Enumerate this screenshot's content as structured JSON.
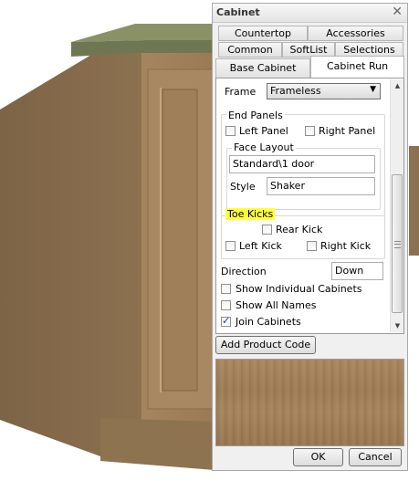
{
  "dialog": {
    "title": "Cabinet",
    "close_glyph": "✕"
  },
  "tabs": {
    "row1": [
      "Countertop",
      "Accessories"
    ],
    "row2": [
      "Common",
      "SoftList",
      "Selections"
    ],
    "row3": [
      "Base Cabinet",
      "Cabinet Run"
    ],
    "active": "Cabinet Run"
  },
  "frame": {
    "label": "Frame",
    "value": "Frameless"
  },
  "end_panels": {
    "legend": "End Panels",
    "left": {
      "label": "Left Panel",
      "checked": false
    },
    "right": {
      "label": "Right Panel",
      "checked": false
    }
  },
  "face_layout": {
    "legend": "Face Layout",
    "layout_value": "Standard\\1 door",
    "style_label": "Style",
    "style_value": "Shaker"
  },
  "toe_kicks": {
    "legend": "Toe Kicks",
    "highlight_color": "#ffff3c",
    "rear": {
      "label": "Rear Kick",
      "checked": false
    },
    "left": {
      "label": "Left Kick",
      "checked": false
    },
    "right": {
      "label": "Right Kick",
      "checked": false
    }
  },
  "direction": {
    "label": "Direction",
    "value": "Down"
  },
  "options": {
    "show_individual": {
      "label": "Show Individual Cabinets",
      "checked": false
    },
    "show_all_names": {
      "label": "Show All Names",
      "checked": false
    },
    "join_cabinets": {
      "label": "Join Cabinets",
      "checked": true
    }
  },
  "buttons": {
    "add_product_code": "Add Product Code",
    "ok": "OK",
    "cancel": "Cancel"
  },
  "icons": {
    "scroll_up": "▲",
    "scroll_down": "▼",
    "dropdown": "▼"
  },
  "colors": {
    "cabinet_wood": "#9c7a52",
    "countertop": "#6e7a52",
    "swatch_wood": "#a4835a"
  }
}
